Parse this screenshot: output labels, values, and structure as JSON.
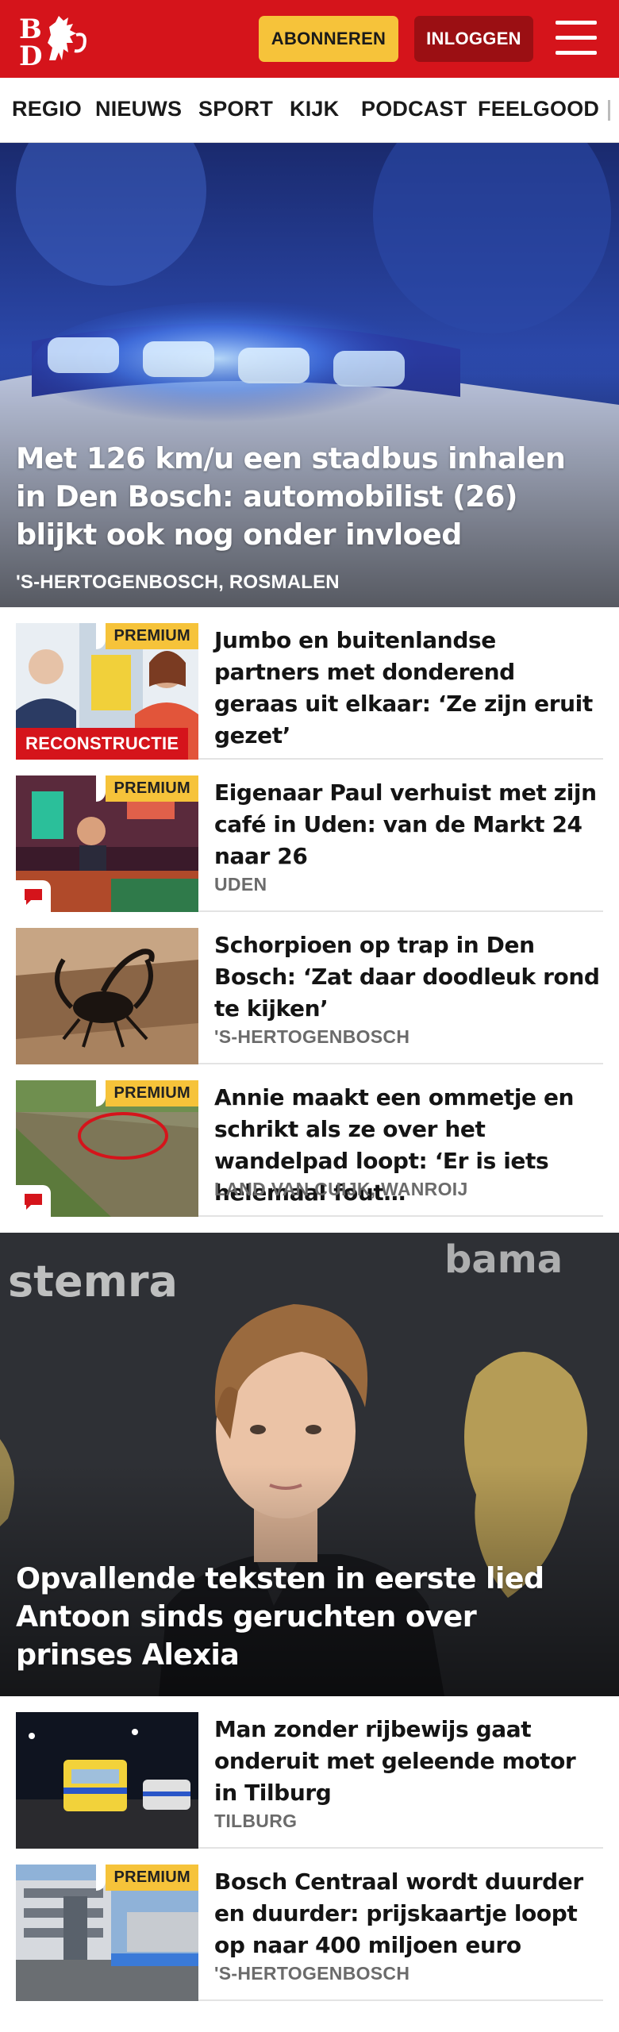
{
  "header": {
    "logo_text": "BD",
    "subscribe_label": "ABONNEREN",
    "login_label": "INLOGGEN",
    "menu_icon": "hamburger-icon",
    "brand_color": "#d5141b"
  },
  "nav": {
    "items": [
      {
        "label": "REGIO"
      },
      {
        "label": "NIEUWS"
      },
      {
        "label": "SPORT"
      },
      {
        "label": "KIJK"
      },
      {
        "label": "PODCAST"
      },
      {
        "label": "FEELGOOD"
      }
    ]
  },
  "hero1": {
    "title": "Met 126 km/u een stadbus inhalen in Den Bosch: automobilist (26) blijkt ook nog onder invloed",
    "location": "'S-HERTOGENBOSCH, ROSMALEN"
  },
  "articles1": [
    {
      "badge": "PREMIUM",
      "label": "RECONSTRUCTIE",
      "title": "Jumbo en buitenlandse partners met donderend geraas uit elkaar: ‘Ze zijn eruit gezet’",
      "location": ""
    },
    {
      "badge": "PREMIUM",
      "title": "Eigenaar Paul verhuist met zijn café in Uden: van de Markt 24 naar 26",
      "location": "UDEN"
    },
    {
      "title": "Schorpioen op trap in Den Bosch: ‘Zat daar doodleuk rond te kijken’",
      "location": "'S-HERTOGENBOSCH"
    },
    {
      "badge": "PREMIUM",
      "title": "Annie maakt een ommetje en schrikt als ze over het wandelpad loopt: ‘Er is iets helemaal fout…",
      "location": "LAND VAN CUIJK, WANROIJ"
    }
  ],
  "hero2": {
    "title": "Opvallende teksten in eerste lied Antoon sinds geruchten over prinses Alexia"
  },
  "articles2": [
    {
      "title": "Man zonder rijbewijs gaat onderuit met geleende motor in Tilburg",
      "location": "TILBURG"
    },
    {
      "badge": "PREMIUM",
      "title": "Bosch Centraal wordt duurder en duurder: prijskaartje loopt op naar 400 miljoen euro",
      "location": "'S-HERTOGENBOSCH"
    }
  ]
}
